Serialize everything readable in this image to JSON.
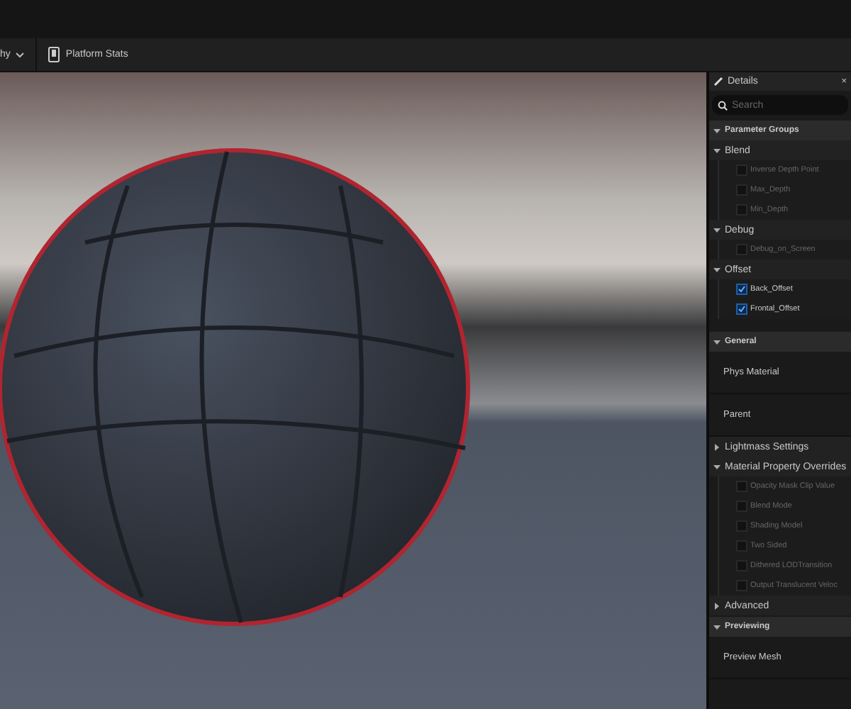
{
  "toolbar": [
    {
      "label": "hy",
      "kind": "dropdown"
    },
    {
      "label": "Platform Stats",
      "kind": "button"
    }
  ],
  "details": {
    "title": "Details",
    "close": "×",
    "search": {
      "placeholder": "Search"
    },
    "tree": [
      {
        "kind": "category",
        "label": "Parameter Groups",
        "expanded": true,
        "children": [
          {
            "kind": "group",
            "label": "Blend",
            "expanded": true,
            "children": [
              {
                "kind": "param",
                "label": "Inverse Depth Point",
                "checked": false,
                "disabled": true
              },
              {
                "kind": "param",
                "label": "Max_Depth",
                "checked": false,
                "disabled": true
              },
              {
                "kind": "param",
                "label": "Min_Depth",
                "checked": false,
                "disabled": true
              }
            ]
          },
          {
            "kind": "group",
            "label": "Debug",
            "expanded": true,
            "children": [
              {
                "kind": "param",
                "label": "Debug_on_Screen",
                "checked": false,
                "disabled": true
              }
            ]
          },
          {
            "kind": "group",
            "label": "Offset",
            "expanded": true,
            "children": [
              {
                "kind": "param",
                "label": "Back_Offset",
                "checked": true,
                "disabled": false
              },
              {
                "kind": "param",
                "label": "Frontal_Offset",
                "checked": true,
                "disabled": false
              }
            ]
          }
        ]
      },
      {
        "kind": "category",
        "label": "General",
        "expanded": true,
        "children": [
          {
            "kind": "property",
            "label": "Phys Material"
          },
          {
            "kind": "property",
            "label": "Parent"
          },
          {
            "kind": "group",
            "label": "Lightmass Settings",
            "expanded": false
          },
          {
            "kind": "group",
            "label": "Material Property Overrides",
            "expanded": true,
            "children": [
              {
                "kind": "param",
                "label": "Opacity Mask Clip Value",
                "checked": false,
                "disabled": true
              },
              {
                "kind": "param",
                "label": "Blend Mode",
                "checked": false,
                "disabled": true
              },
              {
                "kind": "param",
                "label": "Shading Model",
                "checked": false,
                "disabled": true
              },
              {
                "kind": "param",
                "label": "Two Sided",
                "checked": false,
                "disabled": true
              },
              {
                "kind": "param",
                "label": "Dithered LODTransition",
                "checked": false,
                "disabled": true
              },
              {
                "kind": "param",
                "label": "Output Translucent Veloc",
                "checked": false,
                "disabled": true
              }
            ]
          },
          {
            "kind": "group",
            "label": "Advanced",
            "expanded": false
          }
        ]
      },
      {
        "kind": "category",
        "label": "Previewing",
        "expanded": true,
        "children": [
          {
            "kind": "property",
            "label": "Preview Mesh"
          }
        ]
      }
    ]
  }
}
